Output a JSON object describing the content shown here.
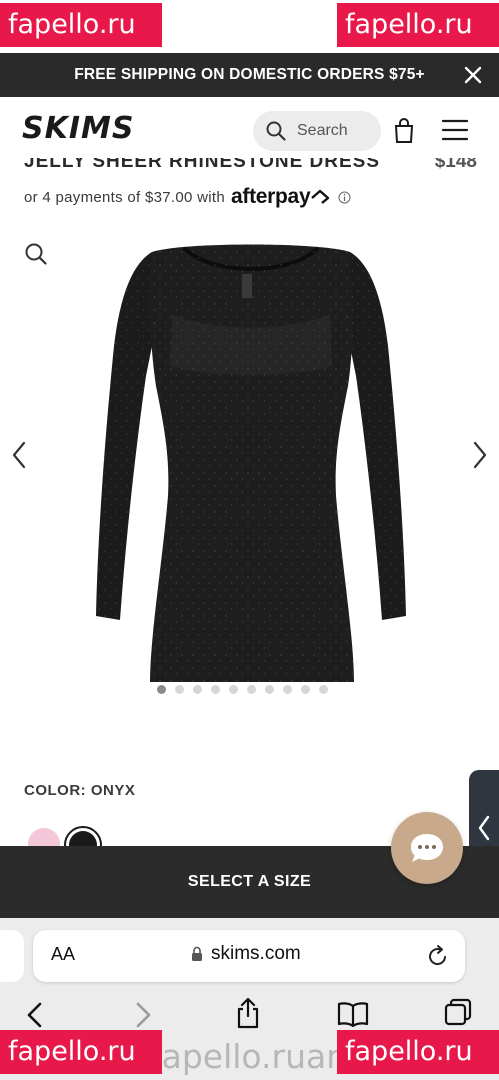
{
  "watermark": {
    "text": "fapello.ru",
    "bottom_text": "fapello.ruans.com/l",
    "color": "#e8184a"
  },
  "promo": {
    "text": "FREE SHIPPING ON DOMESTIC ORDERS $75+",
    "close_icon": "close-icon"
  },
  "header": {
    "logo": "SKIMS",
    "search_placeholder": "Search",
    "icons": [
      "search-icon",
      "bag-icon",
      "hamburger-menu-icon"
    ]
  },
  "product": {
    "title": "JELLY SHEER RHINESTONE DRESS",
    "price": "$148",
    "payments_text": "or 4 payments of $37.00 with",
    "afterpay": "afterpay",
    "color_label": "COLOR: ONYX",
    "swatches": [
      "#f3c6d8",
      "#1a1a1a"
    ],
    "gallery_dots": 10,
    "gallery_active": 0
  },
  "cta": {
    "select_size": "SELECT A SIZE"
  },
  "browser": {
    "aa_label": "AA",
    "url": "skims.com",
    "toolbar_icons": [
      "back-icon",
      "forward-icon",
      "share-icon",
      "bookmarks-icon",
      "tabs-icon"
    ]
  },
  "colors": {
    "banner_bg": "#2a2a2a",
    "cta_bg": "#2b2b2b",
    "chat_bg": "#c9a98c",
    "side_tab_bg": "#2f3640"
  }
}
